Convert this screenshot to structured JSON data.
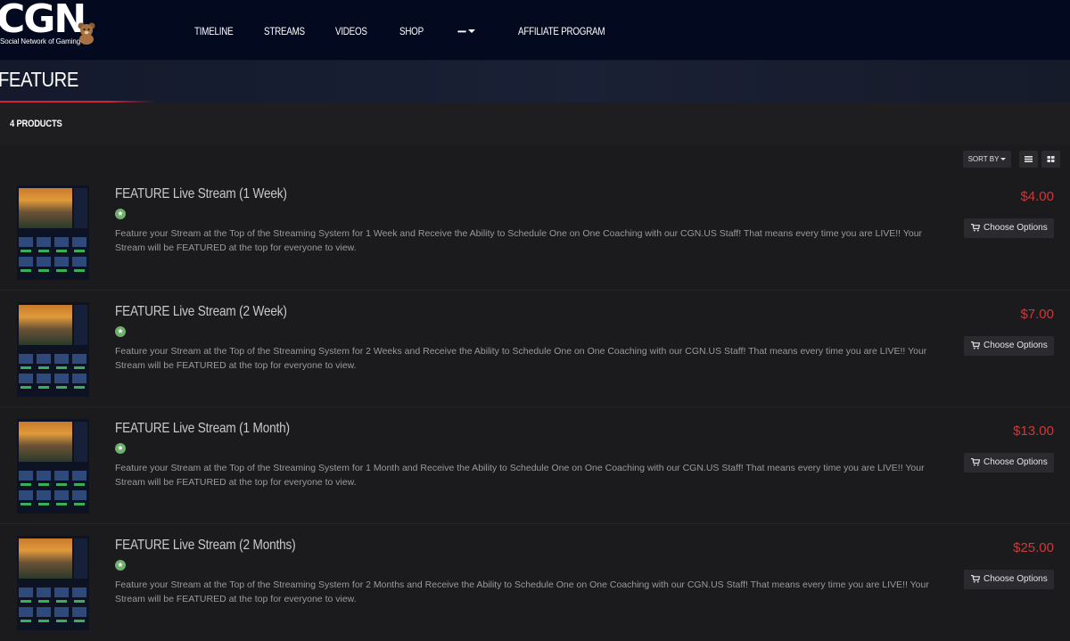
{
  "brand": {
    "logo_text": "CGN",
    "tagline": "Social Network of Gaming"
  },
  "nav": {
    "items": [
      "TIMELINE",
      "STREAMS",
      "VIDEOS",
      "SHOP"
    ],
    "more_label": "•••••",
    "affiliate": "AFFILIATE PROGRAM"
  },
  "page": {
    "title": "FEATURE",
    "count": "4 PRODUCTS",
    "accent_color": "#d2233a"
  },
  "toolbar": {
    "sort_label": "SORT BY",
    "list_view_icon": "list-view-icon",
    "grid_view_icon": "grid-view-icon"
  },
  "products": [
    {
      "title": "FEATURE Live Stream (1 Week)",
      "description": "Feature your Stream at the Top of the Streaming System for 1 Week and Receive the Ability to Schedule One on One Coaching with our CGN.US Staff! That means every time you are LIVE!! Your Stream will be FEATURED at the top for everyone to view.",
      "price": "$4.00",
      "button": "Choose Options"
    },
    {
      "title": "FEATURE Live Stream (2 Week)",
      "description": "Feature your Stream at the Top of the Streaming System for 2 Weeks and Receive the Ability to Schedule One on One Coaching with our CGN.US Staff! That means every time you are LIVE!! Your Stream will be FEATURED at the top for everyone to view.",
      "price": "$7.00",
      "button": "Choose Options"
    },
    {
      "title": "FEATURE Live Stream (1 Month)",
      "description": "Feature your Stream at the Top of the Streaming System for 1 Month and Receive the Ability to Schedule One on One Coaching with our CGN.US Staff! That means every time you are LIVE!! Your Stream will be FEATURED at the top for everyone to view.",
      "price": "$13.00",
      "button": "Choose Options"
    },
    {
      "title": "FEATURE Live Stream (2 Months)",
      "description": "Feature your Stream at the Top of the Streaming System for 2 Months and Receive the Ability to Schedule One on One Coaching with our CGN.US Staff! That means every time you are LIVE!! Your Stream will be FEATURED at the top for everyone to view.",
      "price": "$25.00",
      "button": "Choose Options"
    }
  ]
}
